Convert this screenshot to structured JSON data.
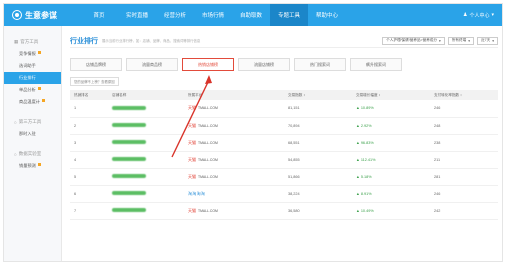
{
  "brand": {
    "logo_text": "生意参谋",
    "accent": "#2aa3e8",
    "highlight": "#e24b3b"
  },
  "nav": {
    "items": [
      {
        "label": "首页"
      },
      {
        "label": "实时直播"
      },
      {
        "label": "经营分析"
      },
      {
        "label": "市场行情"
      },
      {
        "label": "自助取数"
      },
      {
        "label": "专题工具"
      },
      {
        "label": "帮助中心"
      }
    ],
    "active_index": 5,
    "user_label": "个人中心"
  },
  "sidebar": {
    "groups": [
      {
        "title": "官方工具",
        "items": [
          {
            "label": "竞争情报",
            "dot": true
          },
          {
            "label": "选词助手",
            "dot": false
          },
          {
            "label": "行业排行",
            "dot": false,
            "active": true
          },
          {
            "label": "单品分析",
            "dot": true
          },
          {
            "label": "商品温度计",
            "dot": true
          }
        ]
      },
      {
        "title": "第三方工具",
        "items": [
          {
            "label": "那时入驻",
            "dot": false
          }
        ]
      },
      {
        "title": "数据实验室",
        "items": [
          {
            "label": "销量预测",
            "dot": true
          }
        ]
      }
    ]
  },
  "main": {
    "title": "行业排行",
    "subtitle": "展示当前行业排行榜，如：店铺、品牌、商品、搜索词等排行信息",
    "controls": {
      "category": "个人护理/保健/营养品>营养成分",
      "device": "所有终端",
      "period": "近7天"
    },
    "tabs": [
      "店铺品牌榜",
      "流量商品榜",
      "热销店铺榜",
      "流量店铺榜",
      "热门搜索词",
      "飙升搜索词"
    ],
    "active_tab": 2,
    "note": "您的品牌不上榜？查看原因",
    "table": {
      "headers": [
        "热销排名",
        "店铺名称",
        "所属平台",
        "交易指数 ↕",
        "交易增长幅度 ↕",
        "支付转化率指数 ↕"
      ],
      "rows": [
        {
          "rank": "1",
          "platform_name": "天猫",
          "platform_suffix": "TMALL.COM",
          "index": "81,151",
          "growth": "▲ 10.89%",
          "conv": "246",
          "store_blur": true
        },
        {
          "rank": "2",
          "platform_name": "天猫",
          "platform_suffix": "TMALL.COM",
          "index": "70,894",
          "growth": "▲ 2.92%",
          "conv": "248",
          "store_blur": true
        },
        {
          "rank": "3",
          "platform_name": "天猫",
          "platform_suffix": "TMALL.COM",
          "index": "68,551",
          "growth": "▲ 96.83%",
          "conv": "238",
          "store_blur": true
        },
        {
          "rank": "4",
          "platform_name": "天猫",
          "platform_suffix": "TMALL.COM",
          "index": "54,855",
          "growth": "▲ 112.41%",
          "conv": "211",
          "store_blur": true
        },
        {
          "rank": "5",
          "platform_name": "天猫",
          "platform_suffix": "TMALL.COM",
          "index": "51,866",
          "growth": "▲ 5.18%",
          "conv": "281",
          "store_blur": true
        },
        {
          "rank": "6",
          "platform_name": "淘淘淘淘",
          "platform_suffix": "",
          "index": "38,224",
          "growth": "▲ 8.91%",
          "conv": "246",
          "store_blur": true,
          "blue": true
        },
        {
          "rank": "7",
          "platform_name": "天猫",
          "platform_suffix": "TMALL.COM",
          "index": "36,580",
          "growth": "▲ 10.49%",
          "conv": "242",
          "store_blur": true
        }
      ]
    }
  }
}
